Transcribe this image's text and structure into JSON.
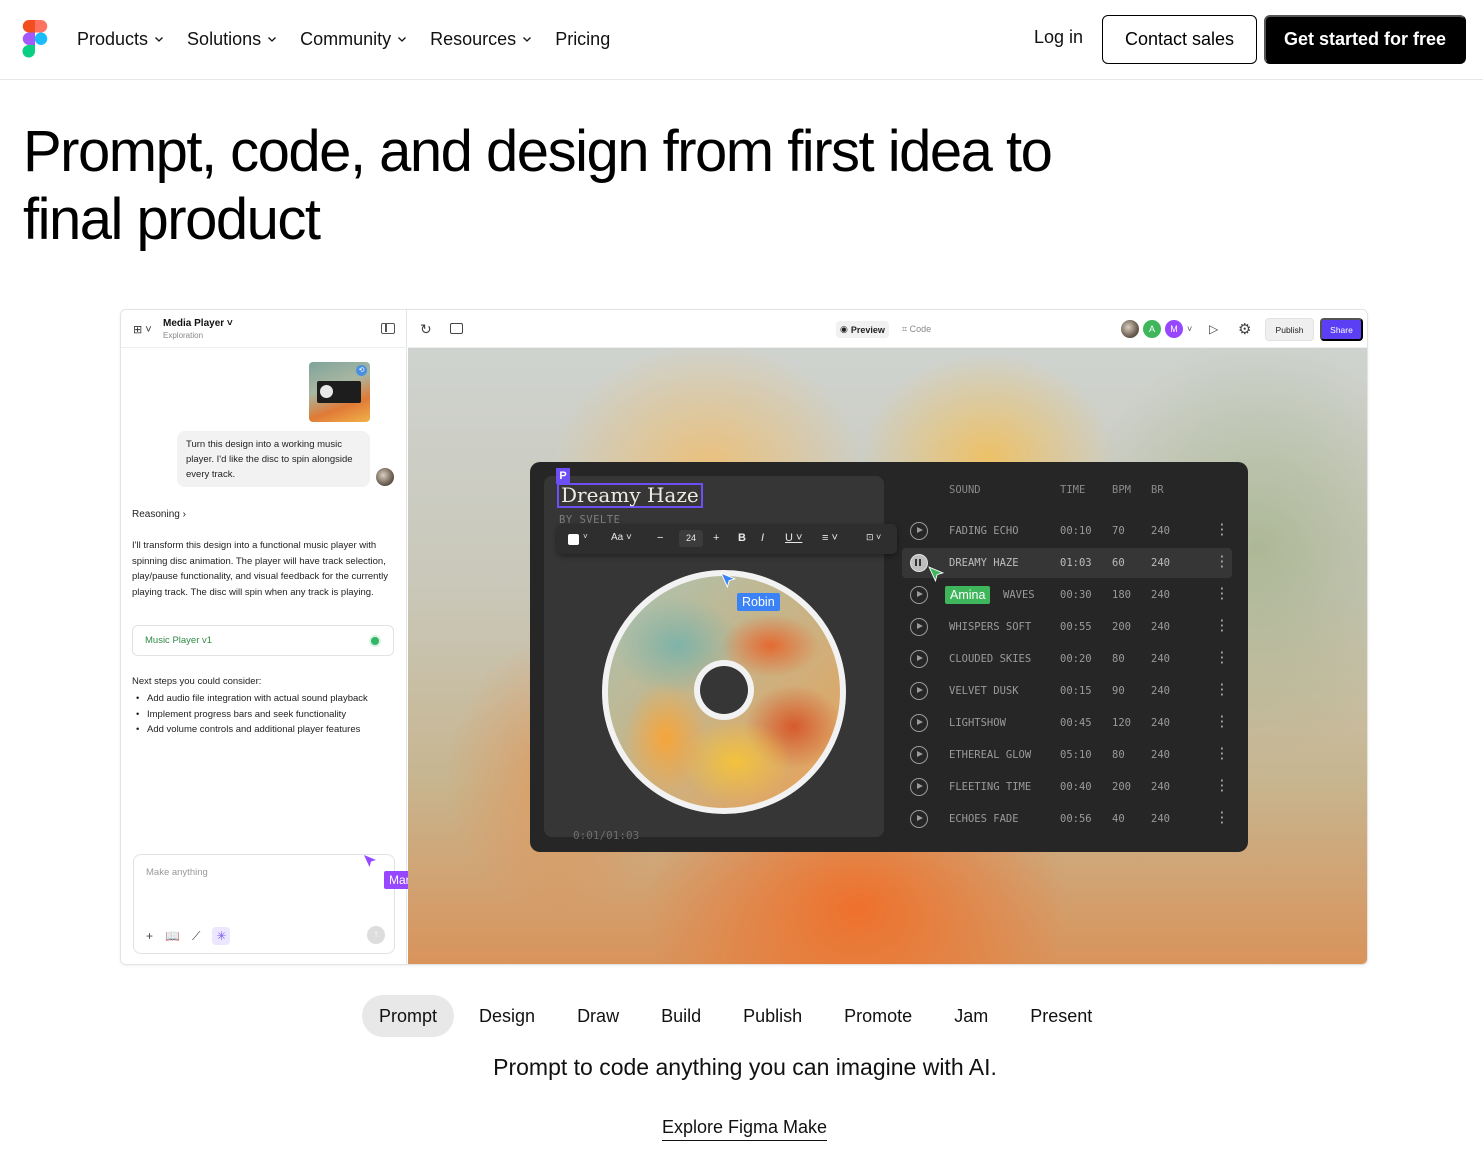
{
  "nav": {
    "links": [
      "Products",
      "Solutions",
      "Community",
      "Resources",
      "Pricing"
    ],
    "login": "Log in",
    "contact": "Contact sales",
    "cta": "Get started for free"
  },
  "hero": {
    "line1": "Prompt, code, and design from first idea to",
    "line2": "final product"
  },
  "app": {
    "project_title": "Media Player",
    "project_sub": "Exploration",
    "user_message": "Turn this design into a working music player. I'd like the disc to spin alongside every track.",
    "reasoning": "Reasoning",
    "reply": "I'll transform this design into a functional music player with spinning disc animation. The player will have track selection, play/pause functionality, and visual feedback for the currently playing track. The disc will spin when any track is playing.",
    "version_card": "Music Player v1",
    "next_title": "Next steps you could consider:",
    "next_steps": [
      "Add audio file integration with actual sound playback",
      "Implement progress bars and seek functionality",
      "Add volume controls and additional player features"
    ],
    "prompt_placeholder": "Make anything",
    "toolbar": {
      "preview": "Preview",
      "code": "Code",
      "publish": "Publish",
      "share": "Share",
      "avatars": [
        "A",
        "M"
      ]
    },
    "cursors": {
      "maria": "Maria",
      "robin": "Robin",
      "amina": "Amina"
    },
    "player": {
      "p_tag": "P",
      "title": "Dreamy Haze",
      "artist": "BY SVELTE",
      "font_size": "24",
      "time": "0:01/01:03",
      "headers": [
        "SOUND",
        "TIME",
        "BPM",
        "BR"
      ],
      "tracks": [
        {
          "name": "FADING ECHO",
          "time": "00:10",
          "bpm": "70",
          "br": "240"
        },
        {
          "name": "DREAMY HAZE",
          "time": "01:03",
          "bpm": "60",
          "br": "240"
        },
        {
          "name": "WAVES",
          "time": "00:30",
          "bpm": "180",
          "br": "240"
        },
        {
          "name": "WHISPERS SOFT",
          "time": "00:55",
          "bpm": "200",
          "br": "240"
        },
        {
          "name": "CLOUDED SKIES",
          "time": "00:20",
          "bpm": "80",
          "br": "240"
        },
        {
          "name": "VELVET DUSK",
          "time": "00:15",
          "bpm": "90",
          "br": "240"
        },
        {
          "name": "LIGHTSHOW",
          "time": "00:45",
          "bpm": "120",
          "br": "240"
        },
        {
          "name": "ETHEREAL GLOW",
          "time": "05:10",
          "bpm": "80",
          "br": "240"
        },
        {
          "name": "FLEETING TIME",
          "time": "00:40",
          "bpm": "200",
          "br": "240"
        },
        {
          "name": "ECHOES FADE",
          "time": "00:56",
          "bpm": "40",
          "br": "240"
        }
      ]
    }
  },
  "tabs": [
    "Prompt",
    "Design",
    "Draw",
    "Build",
    "Publish",
    "Promote",
    "Jam",
    "Present"
  ],
  "tagline": "Prompt to code anything you can imagine with AI.",
  "explore": "Explore Figma Make",
  "colors": {
    "brand_purple": "#9747ff",
    "share_blue": "#5a3ff5",
    "amina_green": "#3fb55c",
    "robin_blue": "#3b82f6"
  }
}
